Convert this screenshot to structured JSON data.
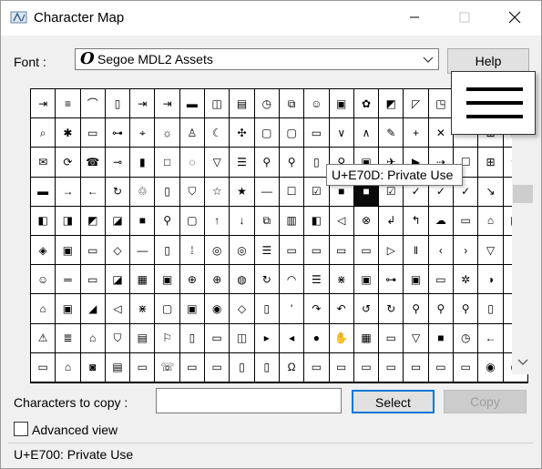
{
  "window": {
    "title": "Character Map",
    "icons": {
      "app": "character-map-icon",
      "minimize": "minimize-icon",
      "maximize": "maximize-icon",
      "close": "close-icon"
    }
  },
  "font": {
    "label": "Font :",
    "selected": "Segoe MDL2 Assets",
    "selected_glyph": "O"
  },
  "help_button": "Help",
  "grid": {
    "rows": [
      [
        "⇥",
        "≡",
        "⌒",
        "▯",
        "⇥",
        "⇥",
        "▬",
        "◫",
        "▤",
        "◷",
        "⧉",
        "☺",
        "▣",
        "✿",
        "◩",
        "◸",
        "◳",
        "",
        "",
        ""
      ],
      [
        "⌕",
        "✱",
        "▭",
        "⊶",
        "⌖",
        "☼",
        "♙",
        "☾",
        "✣",
        "▢",
        "▢",
        "▭",
        "∨",
        "∧",
        "✎",
        "+",
        "✕",
        "⋯",
        "⊞",
        "⊟"
      ],
      [
        "✉",
        "⟳",
        "☎",
        "⊸",
        "▮",
        "□",
        "◌",
        "▽",
        "☰",
        "⚲",
        "⚲",
        "▯",
        "⚲",
        "▣",
        "✈",
        "▶",
        "⇢",
        "☐",
        "⊞",
        "☆"
      ],
      [
        "▬",
        "→",
        "←",
        "↻",
        "♲",
        "▯",
        "⛉",
        "☆",
        "★",
        "—",
        "☐",
        "☑",
        "■",
        "■",
        "☑",
        "✓",
        "✓",
        "✓",
        "↘",
        "↖"
      ],
      [
        "◧",
        "◨",
        "◩",
        "◪",
        "■",
        "⚲",
        "▢",
        "↑",
        "↓",
        "⧉",
        "▥",
        "◧",
        "◁",
        "⊗",
        "↲",
        "↰",
        "☁",
        "▭",
        "⌂",
        "▤"
      ],
      [
        "◈",
        "▣",
        "▭",
        "◇",
        "—",
        "▯",
        "⁞",
        "◎",
        "◎",
        "☰",
        "▭",
        "▭",
        "▭",
        "▭",
        "▷",
        "‖",
        "‹",
        "›",
        "▽",
        ""
      ],
      [
        "☺",
        "═",
        "▭",
        "◪",
        "▦",
        "▣",
        "⊕",
        "⊕",
        "◍",
        "↻",
        "◠",
        "☰",
        "⋇",
        "▣",
        "⊶",
        "▣",
        "▭",
        "✲",
        "◑",
        "‖"
      ],
      [
        "⌂",
        "▣",
        "◢",
        "◁",
        "⋇",
        "▢",
        "▣",
        "◉",
        "◇",
        "▯",
        "'",
        "↷",
        "↶",
        "↺",
        "↻",
        "⚲",
        "⚲",
        "⚲",
        "▯",
        ""
      ],
      [
        "⚠",
        "≣",
        "⌂",
        "⛉",
        "▤",
        "⚐",
        "▯",
        "▭",
        "◫",
        "▸",
        "◂",
        "●",
        "✋",
        "▦",
        "▭",
        "▽",
        "■",
        "◷",
        "←",
        "↑"
      ],
      [
        "▭",
        "⌂",
        "◙",
        "▤",
        "▭",
        "☏",
        "▭",
        "▭",
        "▯",
        "▯",
        "Ω",
        "▭",
        "▭",
        "▭",
        "▭",
        "▭",
        "▭",
        "▭",
        "◉",
        "◉"
      ]
    ],
    "selected_cell": [
      3,
      13
    ]
  },
  "zoom_glyph": "hamburger-icon",
  "tooltip": "U+E70D: Private Use",
  "copy": {
    "label": "Characters to copy :",
    "value": "",
    "select_button": "Select",
    "copy_button": "Copy"
  },
  "advanced": {
    "label": "Advanced view",
    "checked": false
  },
  "status": "U+E700: Private Use"
}
